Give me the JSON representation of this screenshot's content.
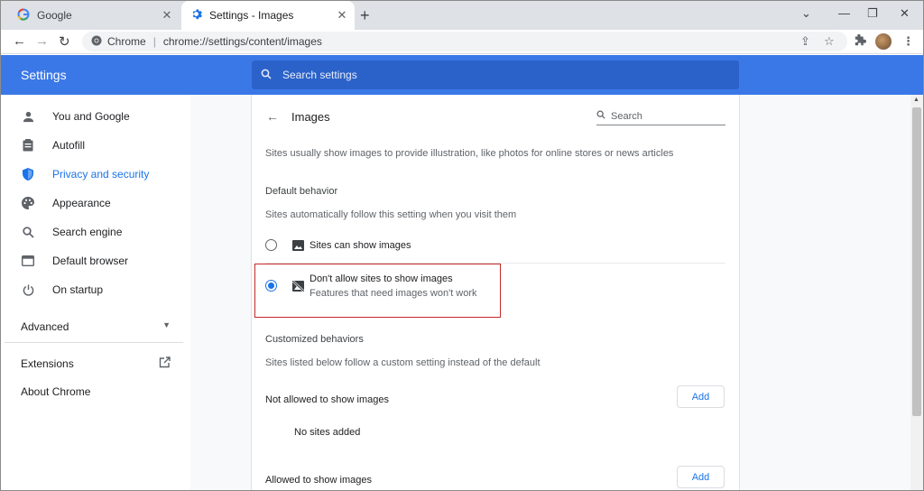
{
  "tabs": [
    {
      "title": "Google",
      "icon": "google-g-icon"
    },
    {
      "title": "Settings - Images",
      "icon": "gear-icon"
    }
  ],
  "toolbar": {
    "site_label": "Chrome",
    "url": "chrome://settings/content/images"
  },
  "header": {
    "title": "Settings",
    "search_placeholder": "Search settings"
  },
  "sidebar": {
    "items": [
      {
        "label": "You and Google",
        "icon": "person-icon"
      },
      {
        "label": "Autofill",
        "icon": "clipboard-icon"
      },
      {
        "label": "Privacy and security",
        "icon": "shield-icon",
        "active": true
      },
      {
        "label": "Appearance",
        "icon": "palette-icon"
      },
      {
        "label": "Search engine",
        "icon": "search-icon"
      },
      {
        "label": "Default browser",
        "icon": "browser-icon"
      },
      {
        "label": "On startup",
        "icon": "power-icon"
      }
    ],
    "advanced": "Advanced",
    "extensions": "Extensions",
    "about": "About Chrome"
  },
  "page": {
    "title": "Images",
    "search_placeholder": "Search",
    "description": "Sites usually show images to provide illustration, like photos for online stores or news articles",
    "default_behavior": {
      "heading": "Default behavior",
      "subtext": "Sites automatically follow this setting when you visit them",
      "options": [
        {
          "label": "Sites can show images",
          "selected": false
        },
        {
          "label": "Don't allow sites to show images",
          "sublabel": "Features that need images won't work",
          "selected": true
        }
      ]
    },
    "customized": {
      "heading": "Customized behaviors",
      "subtext": "Sites listed below follow a custom setting instead of the default",
      "not_allowed_label": "Not allowed to show images",
      "allowed_label": "Allowed to show images",
      "add_label": "Add",
      "empty_text": "No sites added"
    }
  },
  "colors": {
    "accent": "#1a73e8",
    "header_bg": "#3b78e7",
    "highlight_box": "#c62828"
  }
}
